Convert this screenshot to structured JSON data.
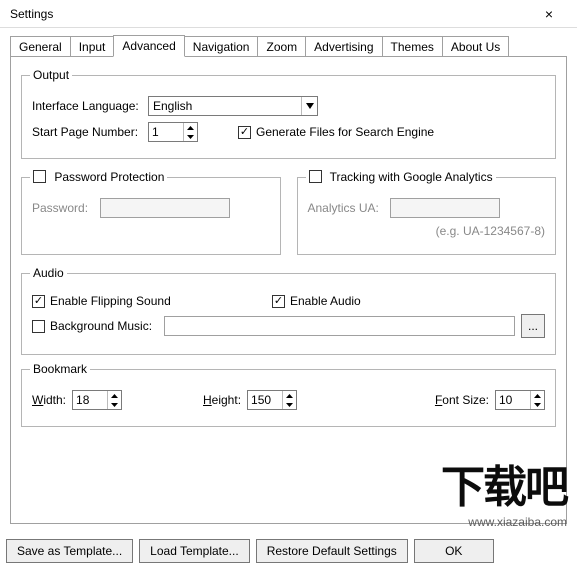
{
  "window": {
    "title": "Settings",
    "close": "×"
  },
  "tabs": {
    "general": "General",
    "input": "Input",
    "advanced": "Advanced",
    "navigation": "Navigation",
    "zoom": "Zoom",
    "advertising": "Advertising",
    "themes": "Themes",
    "about": "About Us"
  },
  "output": {
    "legend": "Output",
    "lang_label": "Interface Language:",
    "lang_value": "English",
    "startpage_label": "Start Page Number:",
    "startpage_value": "1",
    "gen_search_label": "Generate Files for Search Engine"
  },
  "password_group": {
    "legend_label": "Password Protection",
    "pwd_label": "Password:",
    "pwd_value": ""
  },
  "tracking_group": {
    "legend_label": "Tracking with Google Analytics",
    "ua_label": "Analytics UA:",
    "ua_value": "",
    "hint": "(e.g. UA-1234567-8)"
  },
  "audio": {
    "legend": "Audio",
    "flip_label": "Enable Flipping Sound",
    "enable_label": "Enable Audio",
    "bgm_label": "Background Music:",
    "bgm_value": "",
    "browse": "..."
  },
  "bookmark": {
    "legend": "Bookmark",
    "width_pre": "W",
    "width_post": "idth:",
    "width_value": "18",
    "height_pre": "H",
    "height_post": "eight:",
    "height_value": "150",
    "font_pre": "F",
    "font_post": "ont Size:",
    "font_value": "10"
  },
  "buttons": {
    "save_tpl": "Save as Template...",
    "load_tpl": "Load Template...",
    "restore": "Restore Default Settings",
    "ok": "OK"
  },
  "watermark": {
    "big": "下载吧",
    "url": "www.xiazaiba.com"
  }
}
